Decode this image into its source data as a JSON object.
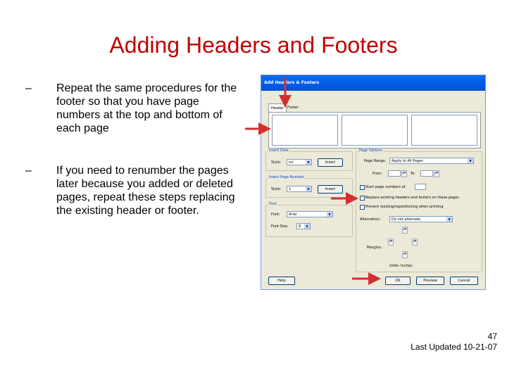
{
  "slide": {
    "title": "Adding Headers and Footers",
    "bullets": [
      {
        "dash": "–",
        "text": "Repeat the same procedures for the footer so that you have page numbers at the top and bottom of each page"
      },
      {
        "dash": "–",
        "text": "If you need to renumber the pages later because you added or deleted pages, repeat these steps replacing the existing header or footer."
      }
    ],
    "page_number": "47",
    "last_updated": "Last Updated 10-21-07"
  },
  "dialog": {
    "title": "Add Headers & Footers",
    "tabs": [
      "Header",
      "Footer"
    ],
    "insert_date": {
      "label": "Insert Date",
      "style_label": "Style:",
      "style_value": "m/",
      "insert_button": "Insert"
    },
    "insert_page_number": {
      "label": "Insert Page Number",
      "style_label": "Style:",
      "style_value": "1",
      "insert_button": "Insert"
    },
    "font": {
      "label": "Font",
      "font_label": "Font:",
      "font_value": "Arial",
      "size_label": "Font Size:",
      "size_value": "8"
    },
    "page_options": {
      "label": "Page Options",
      "page_range_label": "Page Range:",
      "page_range_value": "Apply to All Pages",
      "from_label": "From:",
      "to_label": "To:",
      "start_label": "Start page numbers at",
      "replace_label": "Replace existing headers and footers on these pages",
      "replace_checked": true,
      "prevent_label": "Prevent resizing/repositioning when printing",
      "alternation_label": "Alternation:",
      "alternation_value": "Do not alternate",
      "margins_label": "Margins:",
      "units_label": "Units: Inches"
    },
    "buttons": {
      "help": "Help",
      "ok": "OK",
      "preview": "Preview",
      "cancel": "Cancel"
    }
  },
  "colors": {
    "title": "#c00000",
    "arrow": "#d32f2f",
    "titlebar": "#0a5ee8"
  }
}
